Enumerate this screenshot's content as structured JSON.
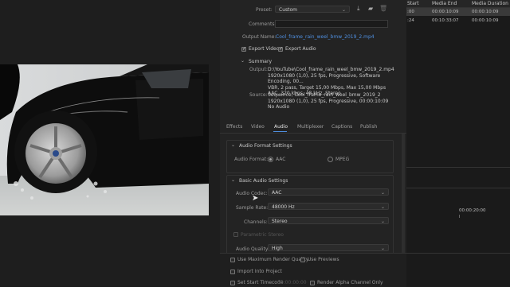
{
  "export": {
    "preset_label": "Preset:",
    "preset_value": "Custom",
    "comments_label": "Comments:",
    "comments_value": "",
    "output_name_label": "Output Name:",
    "output_name_value": "Cool_frame_rain_weel_bmw_2019_2.mp4",
    "export_video_label": "Export Video",
    "export_audio_label": "Export Audio",
    "summary_label": "Summary",
    "output_label": "Output:",
    "output_lines": [
      "D:\\YouTube\\Cool_frame_rain_weel_bmw_2019_2.mp4",
      "1920x1080 (1,0), 25 fps, Progressive, Software Encoding, 00...",
      "VBR, 2 pass, Target 15,00 Mbps, Max 15,00 Mbps",
      "AAC, 320 kbps, 48 kHz, Stereo"
    ],
    "source_label": "Source:",
    "source_lines": [
      "Sequence, Cool_frame_rain_weel_bmw_2019_2",
      "1920x1080 (1,0), 25 fps, Progressive, 00:00:10:09",
      "No Audio"
    ]
  },
  "tabs": [
    "Effects",
    "Video",
    "Audio",
    "Multiplexer",
    "Captions",
    "Publish"
  ],
  "active_tab": "Audio",
  "audio_format": {
    "title": "Audio Format Settings",
    "format_label": "Audio Format:",
    "option_aac": "AAC",
    "option_mpeg": "MPEG"
  },
  "basic_audio": {
    "title": "Basic Audio Settings",
    "codec_label": "Audio Codec:",
    "codec_value": "AAC",
    "sample_rate_label": "Sample Rate:",
    "sample_rate_value": "48000 Hz",
    "channels_label": "Channels:",
    "channels_value": "Stereo",
    "parametric_label": "Parametric Stereo",
    "quality_label": "Audio Quality:",
    "quality_value": "High"
  },
  "bottom_options": {
    "max_render_quality": "Use Maximum Render Quality",
    "use_previews": "Use Previews",
    "import_into_project": "Import Into Project",
    "set_start_timecode": "Set Start Timecode",
    "start_timecode_value": "00:00:00:00",
    "render_alpha": "Render Alpha Channel Only"
  },
  "queue": {
    "col_start": "Start",
    "col_media_end": "Media End",
    "col_media_duration": "Media Duration",
    "rows": [
      {
        "start": ":00",
        "end": "00:00:10:09",
        "duration": "00:00:10:09"
      },
      {
        "start": ":24",
        "end": "00:10:33:07",
        "duration": "00:00:10:09"
      }
    ],
    "timecode": "00:00:20:00"
  }
}
